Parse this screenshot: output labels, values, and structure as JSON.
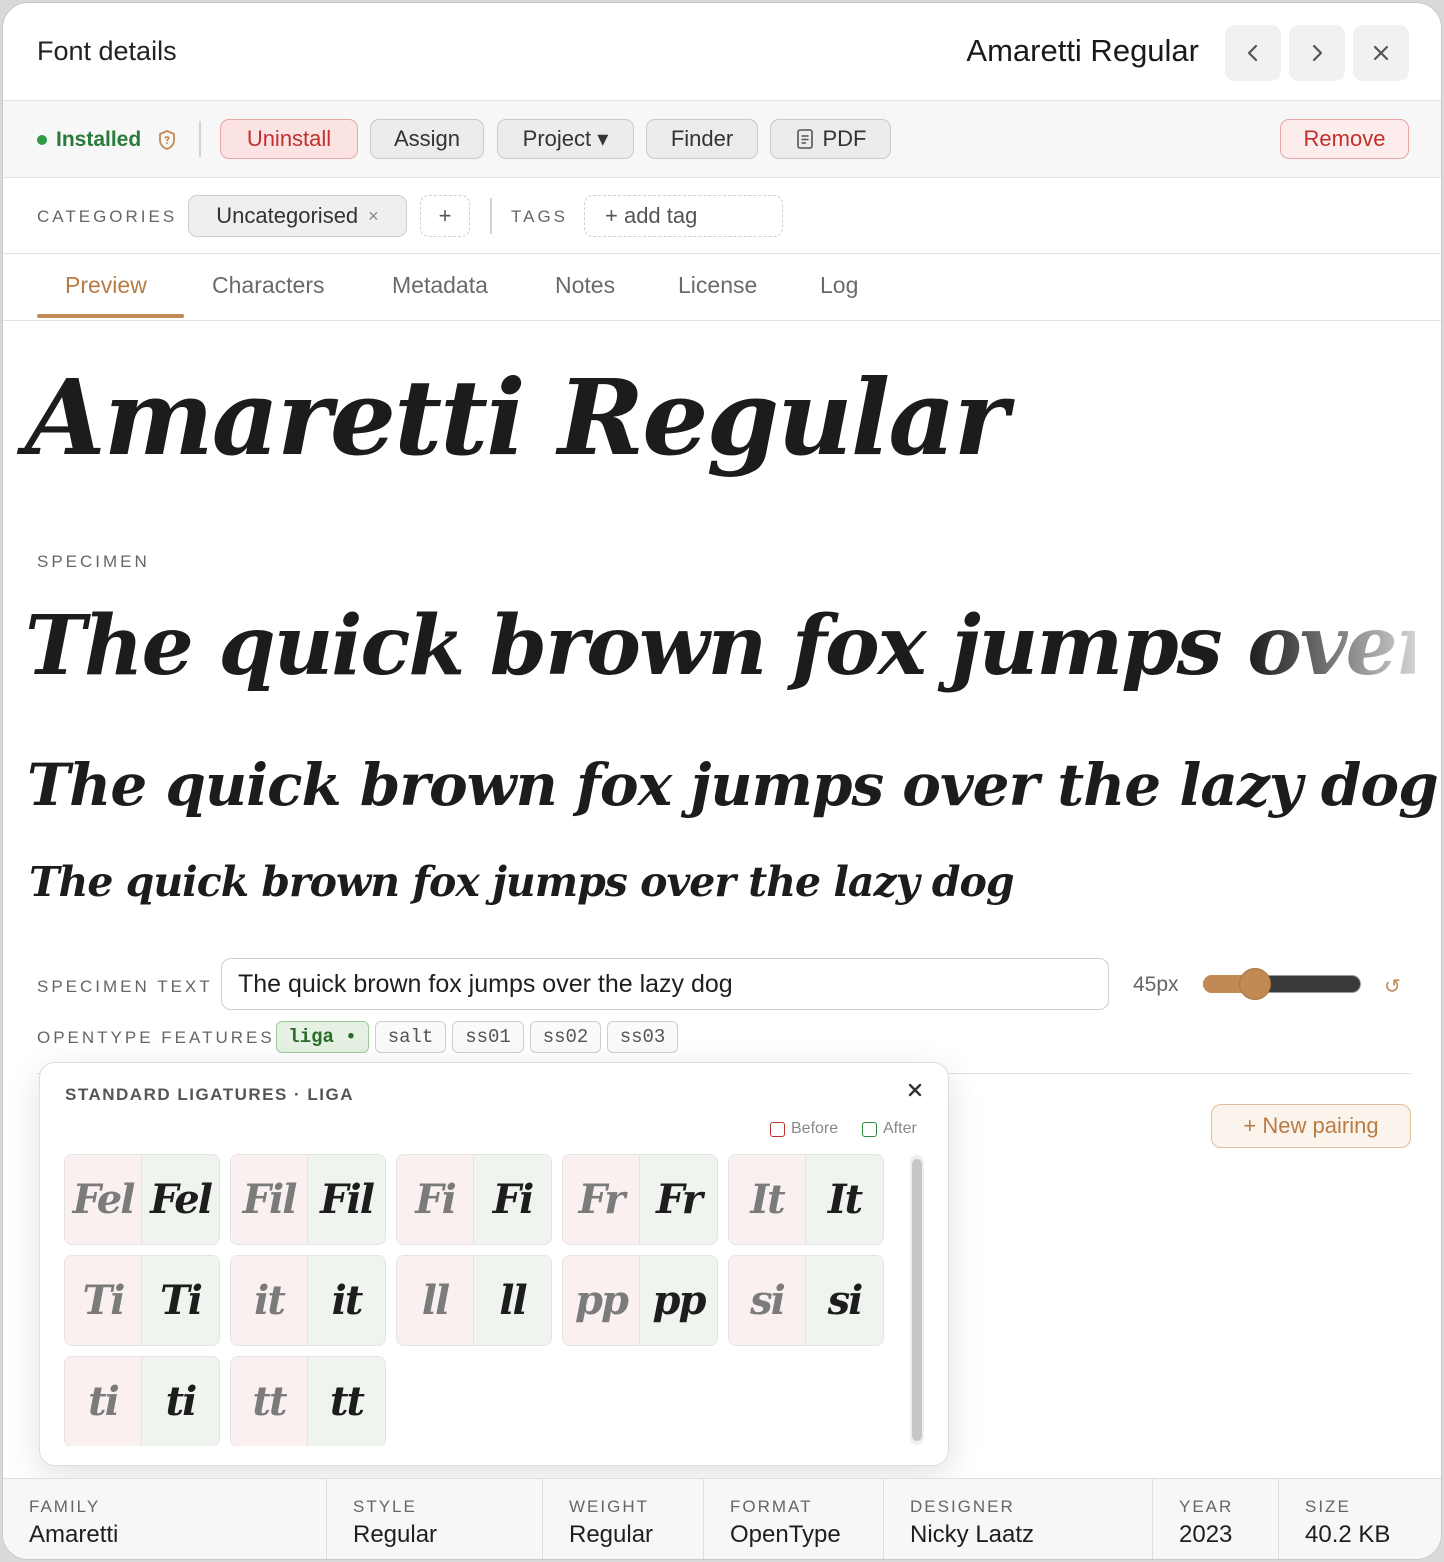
{
  "header": {
    "title": "Font details",
    "font_name": "Amaretti Regular"
  },
  "status": {
    "label": "Installed",
    "color": "#2f9a47"
  },
  "actions": {
    "uninstall": "Uninstall",
    "assign": "Assign",
    "project": "Project ▾",
    "finder": "Finder",
    "pdf": "PDF",
    "remove": "Remove"
  },
  "categories": {
    "label": "CATEGORIES",
    "items": [
      "Uncategorised"
    ],
    "add": "+",
    "tags_label": "TAGS",
    "add_tag": "+ add tag"
  },
  "tabs": [
    "Preview",
    "Characters",
    "Metadata",
    "Notes",
    "License",
    "Log"
  ],
  "active_tab": "Preview",
  "preview": {
    "name_sample": "Amaretti Regular",
    "specimen_label": "SPECIMEN",
    "specimen_lines": [
      "The quick brown fox jumps over the lazy dog",
      "The quick brown fox jumps over the lazy dog",
      "The quick brown fox jumps over the lazy dog"
    ],
    "specimen_text_label": "SPECIMEN TEXT",
    "specimen_text_value": "The quick brown fox jumps over the lazy dog",
    "size_label": "45px",
    "size_slider_fraction": 0.33,
    "reset_icon": "↺",
    "opentype_label": "OPENTYPE FEATURES",
    "features": [
      "liga •",
      "salt",
      "ss01",
      "ss02",
      "ss03"
    ],
    "active_feature": "liga"
  },
  "pairing": {
    "new_pairing": "+ New pairing"
  },
  "popover": {
    "title": "STANDARD LIGATURES · LIGA",
    "legend_before": "Before",
    "legend_after": "After",
    "before_color": "#c0302d",
    "after_color": "#2f8a3c",
    "glyphs": [
      "Fel",
      "Fil",
      "Fi",
      "Fr",
      "It",
      "Ti",
      "it",
      "ll",
      "pp",
      "si",
      "ti",
      "tt"
    ]
  },
  "footer": [
    {
      "key": "FAMILY",
      "value": "Amaretti"
    },
    {
      "key": "STYLE",
      "value": "Regular"
    },
    {
      "key": "WEIGHT",
      "value": "Regular"
    },
    {
      "key": "FORMAT",
      "value": "OpenType"
    },
    {
      "key": "DESIGNER",
      "value": "Nicky Laatz"
    },
    {
      "key": "YEAR",
      "value": "2023"
    },
    {
      "key": "SIZE",
      "value": "40.2 KB"
    }
  ],
  "colors": {
    "accent": "#c18a55",
    "danger": "#c0302d"
  }
}
